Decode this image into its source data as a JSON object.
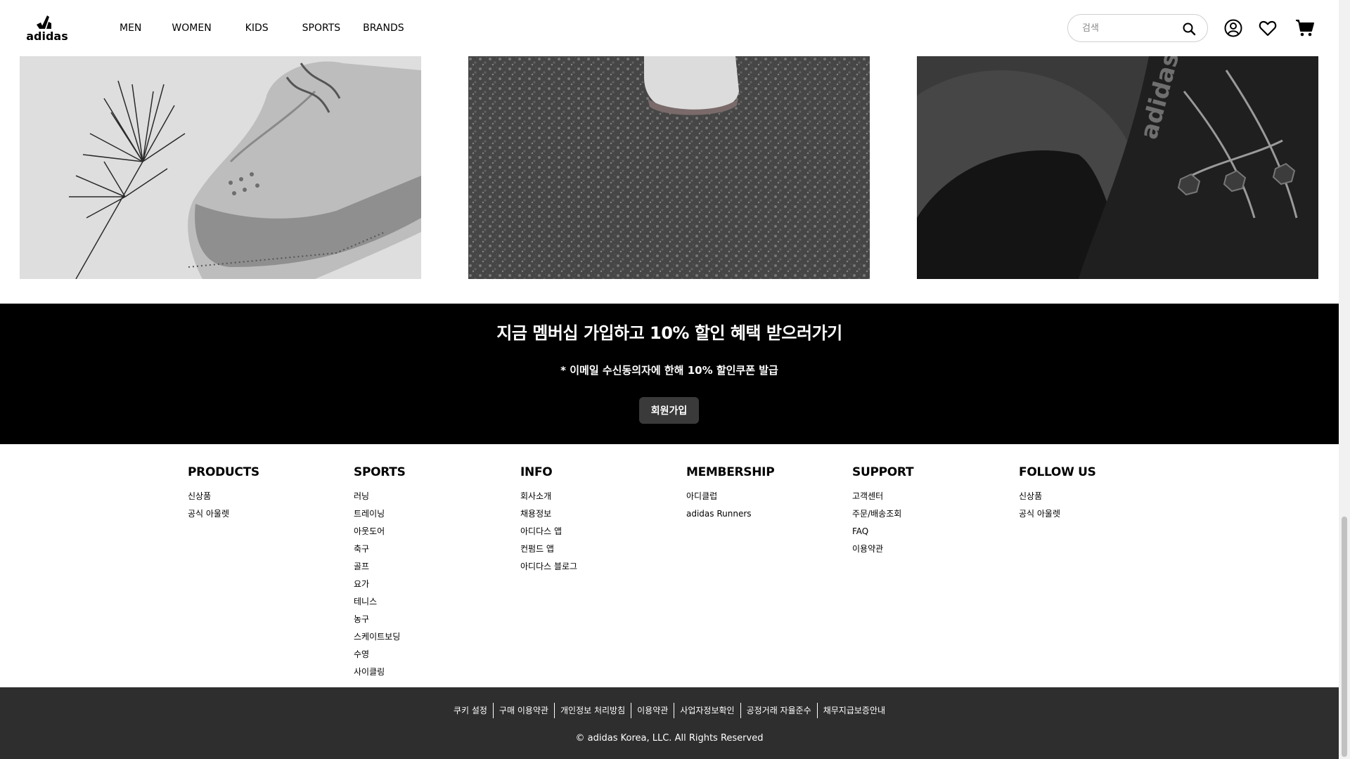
{
  "header": {
    "logo_text": "adidas",
    "nav": [
      "MEN",
      "WOMEN",
      "KIDS",
      "SPORTS",
      "BRANDS"
    ],
    "search_placeholder": "검색",
    "icons": [
      "search-icon",
      "account-icon",
      "wishlist-heart-icon",
      "cart-icon"
    ]
  },
  "gallery": {
    "images": [
      "snow-sneaker-photo",
      "gravel-runner-photo",
      "black-shoe-closeup-photo"
    ]
  },
  "promo": {
    "title": "지금 멤버십 가입하고 10% 할인 혜택 받으러가기",
    "subtitle": "* 이메일 수신동의자에 한해 10% 할인쿠폰 발급",
    "button": "회원가입"
  },
  "footer": {
    "columns": [
      {
        "title": "PRODUCTS",
        "items": [
          "신상품",
          "공식 아울렛"
        ]
      },
      {
        "title": "SPORTS",
        "items": [
          "러닝",
          "트레이닝",
          "아웃도어",
          "축구",
          "골프",
          "요가",
          "테니스",
          "농구",
          "스케이트보딩",
          "수영",
          "사이클링"
        ]
      },
      {
        "title": "INFO",
        "items": [
          "회사소개",
          "채용정보",
          "아디다스 앱",
          "컨펌드 앱",
          "아디다스 블로그"
        ]
      },
      {
        "title": "MEMBERSHIP",
        "items": [
          "아디클럽",
          "adidas Runners"
        ]
      },
      {
        "title": "SUPPORT",
        "items": [
          "고객센터",
          "주문/배송조회",
          "FAQ",
          "이용약관"
        ]
      },
      {
        "title": "FOLLOW US",
        "items": [
          "신상품",
          "공식 아울렛"
        ]
      }
    ]
  },
  "bottom": {
    "legal_links": [
      "쿠키 설정",
      "구매 이용약관",
      "개인정보 처리방침",
      "이용약관",
      "사업자정보확인",
      "공정거래 자율준수",
      "채무지급보증안내"
    ],
    "copyright": "© adidas Korea, LLC. All Rights Reserved"
  },
  "colors": {
    "promo_bg": "#000000",
    "button_bg": "#3a3a3a",
    "bottom_bg": "#2e2e2e"
  }
}
